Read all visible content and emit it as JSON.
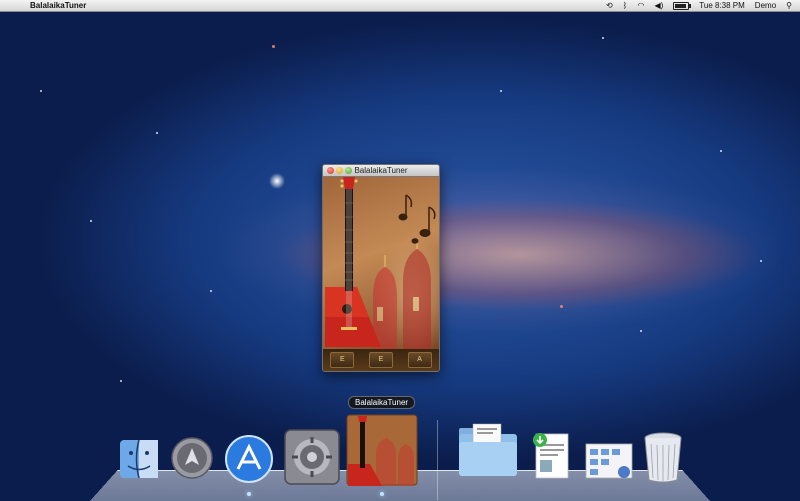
{
  "menubar": {
    "app_name": "BalalaikaTuner",
    "clock": "Tue 8:38 PM",
    "user": "Demo"
  },
  "window": {
    "title": "BalalaikaTuner",
    "string_buttons": [
      "E",
      "E",
      "A"
    ]
  },
  "dock": {
    "tooltip": "BalalaikaTuner",
    "items": [
      {
        "icon": "finder-icon"
      },
      {
        "icon": "launchpad-icon"
      },
      {
        "icon": "app-store-icon"
      },
      {
        "icon": "system-preferences-icon"
      },
      {
        "icon": "balalaika-tuner-icon"
      },
      {
        "icon": "documents-folder-icon"
      },
      {
        "icon": "document-stack-icon"
      },
      {
        "icon": "preview-stack-icon"
      },
      {
        "icon": "trash-icon"
      }
    ]
  }
}
